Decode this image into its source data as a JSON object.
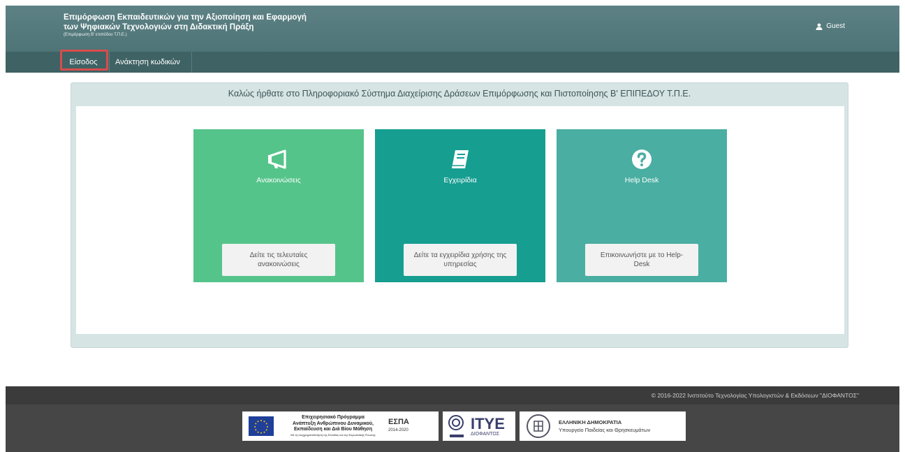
{
  "header": {
    "title_line1": "Επιμόρφωση Εκπαιδευτικών για την Αξιοποίηση και Εφαρμογή",
    "title_line2": "των Ψηφιακών Τεχνολογιών στη Διδακτική Πράξη",
    "subtitle": "(Επιμόρφωση Β' επιπέδου Τ.Π.Ε.)",
    "user_label": "Guest",
    "user_icon": "user-icon"
  },
  "nav": {
    "login_label": "Είσοδος",
    "recover_label": "Ανάκτηση κωδικών"
  },
  "panel": {
    "welcome": "Καλώς ήρθατε στο Πληροφοριακό Σύστημα Διαχείρισης Δράσεων Επιμόρφωσης και Πιστοποίησης Β' ΕΠΙΠΕΔΟΥ Τ.Π.Ε."
  },
  "cards": [
    {
      "title": "Ανακοινώσεις",
      "icon": "megaphone-icon",
      "button": "Δείτε τις τελευταίες ανακοινώσεις",
      "color": "#55c48b"
    },
    {
      "title": "Εγχειρίδια",
      "icon": "book-icon",
      "button": "Δείτε τα εγχειρίδια χρήσης της υπηρεσίας",
      "color": "#169e91"
    },
    {
      "title": "Help Desk",
      "icon": "question-icon",
      "button": "Επικοινωνήστε με το Help-Desk",
      "color": "#4aaea2"
    }
  ],
  "footer": {
    "copyright": "© 2016-2022 Ινστιτούτο Τεχνολογίας Υπολογιστών & Εκδόσεων \"ΔΙΟΦΑΝΤΟΣ\"",
    "eu_label": "Ευρωπαϊκή Ένωση",
    "eu_program_line1": "Επιχειρησιακό Πρόγραμμα",
    "eu_program_line2": "Ανάπτυξη Ανθρώπινου Δυναμικού,",
    "eu_program_line3": "Εκπαίδευση και Διά Βίου Μάθηση",
    "eu_program_small": "Με τη συγχρηματοδότηση της Ελλάδας και της Ευρωπαϊκής Ένωσης",
    "espa_label": "ΕΣΠΑ",
    "espa_years": "2014-2020",
    "ityc_label": "ΙΤΥΕ",
    "ityc_sub": "ΔΙΟΦΑΝΤΟΣ",
    "gr_line1": "ΕΛΛΗΝΙΚΗ ΔΗΜΟΚΡΑΤΙΑ",
    "gr_line2": "Υπουργείο Παιδείας και Θρησκευμάτων"
  },
  "colors": {
    "header_bg": "#527a7d",
    "nav_bg": "#3f6264",
    "highlight": "#d94c4c"
  }
}
